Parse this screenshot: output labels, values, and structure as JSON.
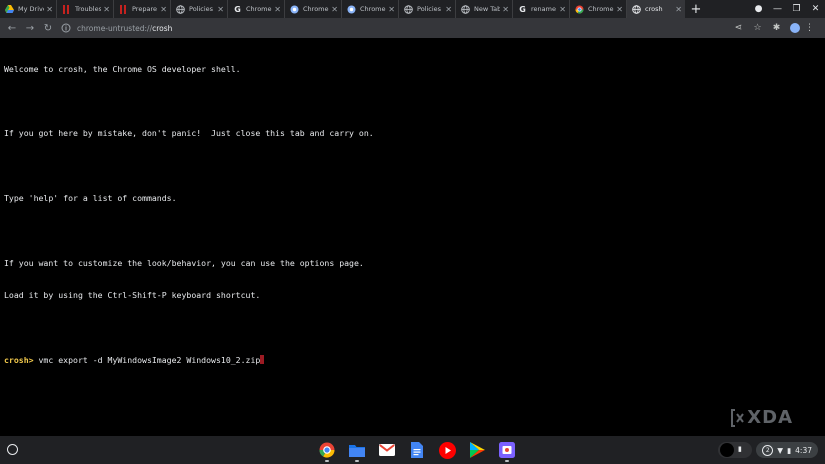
{
  "tabs": [
    {
      "title": "My Drive",
      "icon": "drive-icon"
    },
    {
      "title": "Troubleshoot",
      "icon": "bookmark-icon"
    },
    {
      "title": "Prepare",
      "icon": "bookmark-icon"
    },
    {
      "title": "Policies",
      "icon": "globe-icon"
    },
    {
      "title": "Chrome",
      "icon": "google-icon"
    },
    {
      "title": "Chrome",
      "icon": "chrome-icon"
    },
    {
      "title": "Chrome",
      "icon": "chrome-icon"
    },
    {
      "title": "Policies",
      "icon": "globe-icon"
    },
    {
      "title": "New Tab",
      "icon": "globe-icon"
    },
    {
      "title": "rename",
      "icon": "google-icon"
    },
    {
      "title": "Chrome",
      "icon": "chrome-icon"
    },
    {
      "title": "crosh",
      "icon": "globe-icon",
      "active": true
    }
  ],
  "address_bar": {
    "scheme": "chrome-untrusted://",
    "path": "crosh"
  },
  "terminal": {
    "lines": [
      "Welcome to crosh, the Chrome OS developer shell.",
      "",
      "If you got here by mistake, don't panic!  Just close this tab and carry on.",
      "",
      "Type 'help' for a list of commands.",
      "",
      "If you want to customize the look/behavior, you can use the options page.",
      "Load it by using the Ctrl-Shift-P keyboard shortcut.",
      ""
    ],
    "prompt": "crosh>",
    "command": " vmc export -d MyWindowsImage2 Windows10_2.zip"
  },
  "watermark": "XDA",
  "shelf": {
    "apps": [
      "chrome-icon",
      "files-icon",
      "gmail-icon",
      "docs-icon",
      "youtube-icon",
      "play-store-icon",
      "screen-capture-icon"
    ],
    "time": "4:37",
    "tray_badge": "2"
  },
  "colors": {
    "prompt": "#f2c94c",
    "cursor": "#9c1b23",
    "accent": "#8ab4f8"
  }
}
